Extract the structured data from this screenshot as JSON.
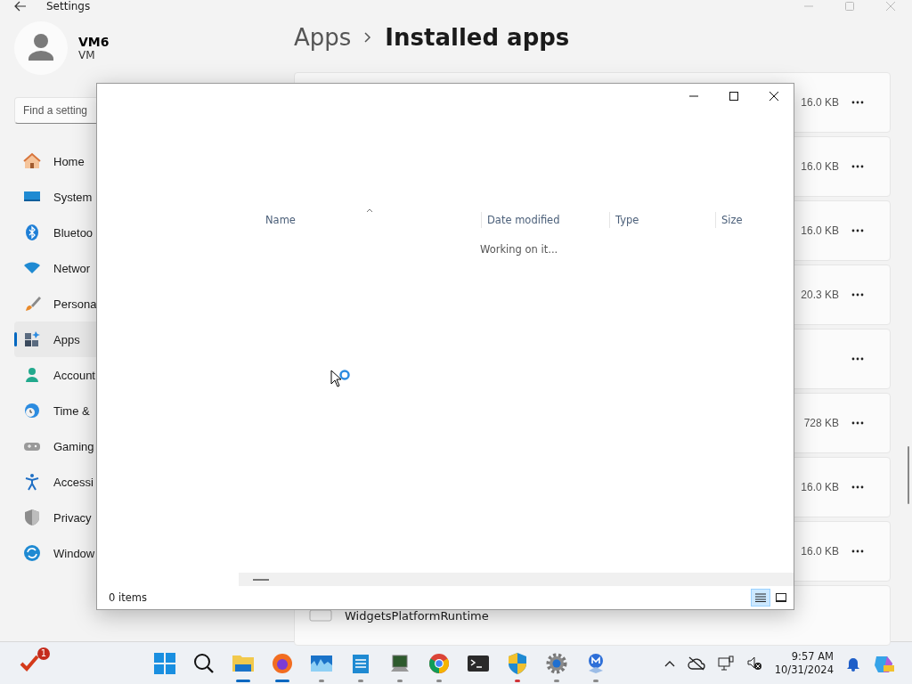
{
  "settings_window": {
    "title": "Settings",
    "user": {
      "name": "VM6",
      "subtitle": "VM"
    },
    "search": {
      "placeholder": "Find a setting"
    },
    "nav": [
      {
        "label": "Home",
        "kind": "home",
        "selected": false
      },
      {
        "label": "System",
        "kind": "system",
        "selected": false
      },
      {
        "label": "Bluetoo",
        "kind": "bluetooth",
        "selected": false
      },
      {
        "label": "Networ",
        "kind": "network",
        "selected": false
      },
      {
        "label": "Persona",
        "kind": "brush",
        "selected": false
      },
      {
        "label": "Apps",
        "kind": "apps",
        "selected": true
      },
      {
        "label": "Account",
        "kind": "account",
        "selected": false
      },
      {
        "label": "Time &",
        "kind": "time",
        "selected": false
      },
      {
        "label": "Gaming",
        "kind": "gaming",
        "selected": false
      },
      {
        "label": "Accessi",
        "kind": "accessibility",
        "selected": false
      },
      {
        "label": "Privacy",
        "kind": "privacy",
        "selected": false
      },
      {
        "label": "Window",
        "kind": "update",
        "selected": false
      }
    ],
    "breadcrumb": {
      "parent": "Apps",
      "current": "Installed apps"
    },
    "apps": [
      {
        "kind": "sized",
        "size": "16.0 KB"
      },
      {
        "kind": "sized",
        "size": "16.0 KB"
      },
      {
        "kind": "sized",
        "size": "16.0 KB"
      },
      {
        "kind": "sized",
        "size": "20.3 KB"
      },
      {
        "kind": "blank"
      },
      {
        "kind": "sized",
        "size": "728 KB"
      },
      {
        "kind": "sized",
        "size": "16.0 KB"
      },
      {
        "kind": "sized",
        "size": "16.0 KB"
      },
      {
        "kind": "named",
        "name": "WidgetsPlatformRuntime"
      }
    ]
  },
  "dialog": {
    "columns": [
      {
        "label": "Name",
        "sorted": true
      },
      {
        "label": "Date modified",
        "sorted": false
      },
      {
        "label": "Type",
        "sorted": false
      },
      {
        "label": "Size",
        "sorted": false
      }
    ],
    "message": "Working on it...",
    "status": "0 items",
    "views": [
      {
        "kind": "details",
        "selected": true
      },
      {
        "kind": "tiles",
        "selected": false
      }
    ]
  },
  "taskbar": {
    "badge": "1",
    "apps": [
      {
        "kind": "start",
        "running": false
      },
      {
        "kind": "search",
        "running": false
      },
      {
        "kind": "folder",
        "running": true,
        "active": true,
        "attention": false
      },
      {
        "kind": "firefox",
        "running": true,
        "active": true,
        "attention": false
      },
      {
        "kind": "monitor",
        "running": true,
        "active": false,
        "attention": false
      },
      {
        "kind": "notepad",
        "running": true,
        "active": false,
        "attention": false
      },
      {
        "kind": "console",
        "running": true,
        "active": false,
        "attention": false
      },
      {
        "kind": "chrome",
        "running": true,
        "active": false,
        "attention": false
      },
      {
        "kind": "terminal",
        "running": false
      },
      {
        "kind": "shield",
        "running": true,
        "active": false,
        "attention": true
      },
      {
        "kind": "gear",
        "running": true,
        "active": false,
        "attention": false
      },
      {
        "kind": "mlogo",
        "running": true,
        "active": false,
        "attention": false
      }
    ],
    "clock": {
      "time": "9:57 AM",
      "date": "10/31/2024"
    }
  }
}
